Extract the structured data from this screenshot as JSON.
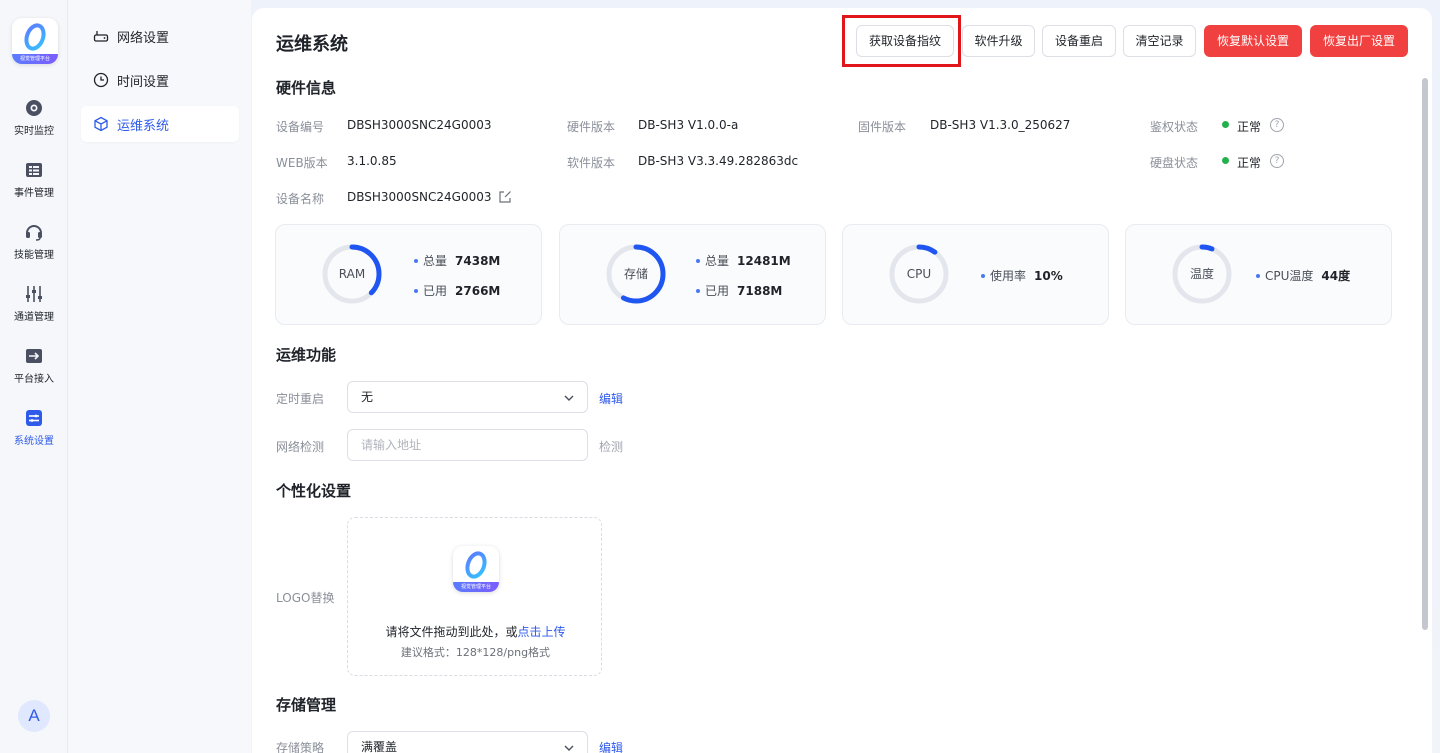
{
  "rail": {
    "logo_caption": "视觉管理平台",
    "items": [
      {
        "label": "实时监控",
        "icon": "camera-icon"
      },
      {
        "label": "事件管理",
        "icon": "list-icon"
      },
      {
        "label": "技能管理",
        "icon": "headset-icon"
      },
      {
        "label": "通道管理",
        "icon": "sliders-icon"
      },
      {
        "label": "平台接入",
        "icon": "arrow-box-icon"
      },
      {
        "label": "系统设置",
        "icon": "settings-panel-icon"
      }
    ],
    "avatar": "A"
  },
  "subnav": {
    "items": [
      {
        "label": "网络设置",
        "icon": "router-icon"
      },
      {
        "label": "时间设置",
        "icon": "clock-icon"
      },
      {
        "label": "运维系统",
        "icon": "cube-icon"
      }
    ]
  },
  "page": {
    "title": "运维系统",
    "buttons": {
      "fingerprint": "获取设备指纹",
      "upgrade": "软件升级",
      "reboot": "设备重启",
      "clear": "清空记录",
      "restore_default": "恢复默认设置",
      "factory_reset": "恢复出厂设置"
    }
  },
  "hardware": {
    "title": "硬件信息",
    "device_no_label": "设备编号",
    "device_no": "DBSH3000SNC24G0003",
    "hw_version_label": "硬件版本",
    "hw_version": "DB-SH3 V1.0.0-a",
    "fw_version_label": "固件版本",
    "fw_version": "DB-SH3 V1.3.0_250627",
    "auth_label": "鉴权状态",
    "auth_status": "正常",
    "web_version_label": "WEB版本",
    "web_version": "3.1.0.85",
    "sw_version_label": "软件版本",
    "sw_version": "DB-SH3 V3.3.49.282863dc",
    "disk_label": "硬盘状态",
    "disk_status": "正常",
    "device_name_label": "设备名称",
    "device_name": "DBSH3000SNC24G0003",
    "status_ok_color": "#22b14c"
  },
  "stats": {
    "ram": {
      "label": "RAM",
      "total_label": "总量",
      "total": "7438M",
      "used_label": "已用",
      "used": "2766M",
      "fraction": 0.372
    },
    "storage": {
      "label": "存储",
      "total_label": "总量",
      "total": "12481M",
      "used_label": "已用",
      "used": "7188M",
      "fraction": 0.576
    },
    "cpu": {
      "label": "CPU",
      "usage_label": "使用率",
      "usage": "10%",
      "fraction": 0.1
    },
    "temp": {
      "label": "温度",
      "temp_label": "CPU温度",
      "temp": "44度",
      "fraction": 0.06
    },
    "accent": "#1f55f0"
  },
  "ops": {
    "title": "运维功能",
    "reboot_label": "定时重启",
    "reboot_value": "无",
    "reboot_edit": "编辑",
    "net_label": "网络检测",
    "net_placeholder": "请输入地址",
    "net_check": "检测"
  },
  "personal": {
    "title": "个性化设置",
    "logo_label": "LOGO替换",
    "upload_hint": "请将文件拖动到此处，或",
    "upload_link": "点击上传",
    "upload_format": "建议格式：128*128/png格式",
    "logo_caption": "视觉管理平台"
  },
  "storage_mgmt": {
    "title": "存储管理",
    "policy_label": "存储策略",
    "policy_value": "满覆盖",
    "policy_edit": "编辑"
  },
  "colors": {
    "primary": "#2f5bea",
    "danger": "#f04040",
    "highlight": "#e0161b"
  }
}
